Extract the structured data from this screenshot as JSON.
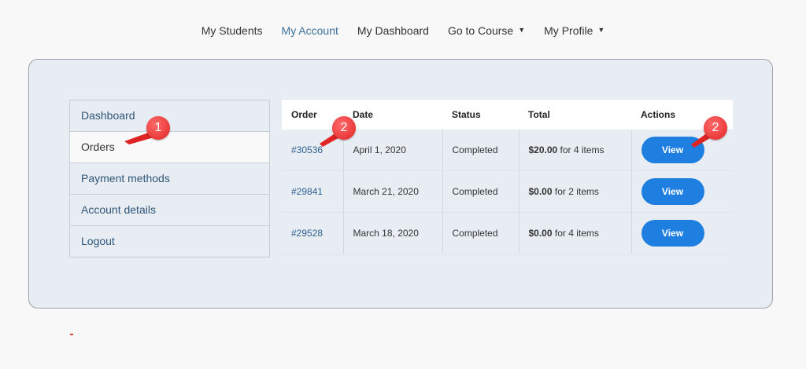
{
  "nav": {
    "items": [
      {
        "label": "My Students",
        "active": false,
        "dropdown": false
      },
      {
        "label": "My Account",
        "active": true,
        "dropdown": false
      },
      {
        "label": "My Dashboard",
        "active": false,
        "dropdown": false
      },
      {
        "label": "Go to Course",
        "active": false,
        "dropdown": true
      },
      {
        "label": "My Profile",
        "active": false,
        "dropdown": true
      }
    ]
  },
  "sidebar": {
    "items": [
      {
        "label": "Dashboard"
      },
      {
        "label": "Orders"
      },
      {
        "label": "Payment methods"
      },
      {
        "label": "Account details"
      },
      {
        "label": "Logout"
      }
    ]
  },
  "orders": {
    "headers": {
      "order": "Order",
      "date": "Date",
      "status": "Status",
      "total": "Total",
      "actions": "Actions"
    },
    "rows": [
      {
        "order": "#30536",
        "date": "April 1, 2020",
        "status": "Completed",
        "total_amount": "$20.00",
        "total_suffix": " for 4 items",
        "action": "View"
      },
      {
        "order": "#29841",
        "date": "March 21, 2020",
        "status": "Completed",
        "total_amount": "$0.00",
        "total_suffix": " for 2 items",
        "action": "View"
      },
      {
        "order": "#29528",
        "date": "March 18, 2020",
        "status": "Completed",
        "total_amount": "$0.00",
        "total_suffix": " for 4 items",
        "action": "View"
      }
    ]
  },
  "callouts": {
    "one": "1",
    "two_a": "2",
    "two_b": "2"
  },
  "colors": {
    "accent": "#1e7fe0",
    "link": "#2f5f8f",
    "callout": "#e02323"
  }
}
